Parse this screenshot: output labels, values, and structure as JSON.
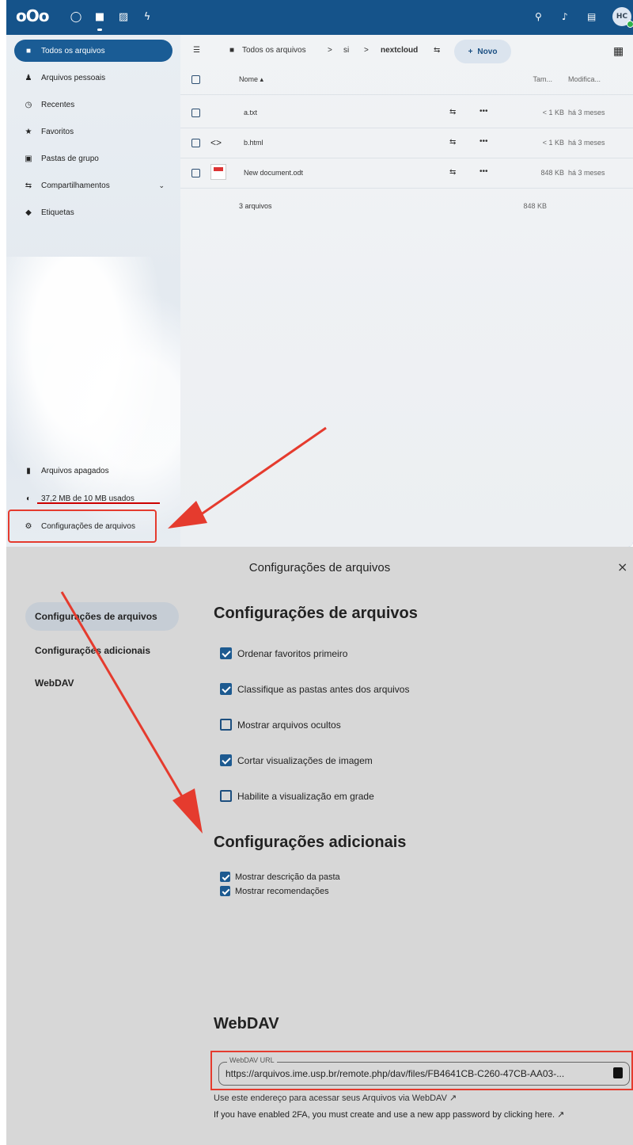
{
  "topbar": {
    "logo": "oOo",
    "apps": [
      "dashboard-icon",
      "files-icon",
      "photos-icon",
      "activity-icon"
    ],
    "avatar_initials": "HC"
  },
  "sidebar": {
    "items": [
      {
        "label": "Todos os arquivos",
        "icon": "folder-icon",
        "glyph": "■"
      },
      {
        "label": "Arquivos pessoais",
        "icon": "user-icon",
        "glyph": "♟"
      },
      {
        "label": "Recentes",
        "icon": "clock-icon",
        "glyph": "◷"
      },
      {
        "label": "Favoritos",
        "icon": "star-icon",
        "glyph": "★"
      },
      {
        "label": "Pastas de grupo",
        "icon": "group-folder-icon",
        "glyph": "▣"
      },
      {
        "label": "Compartilhamentos",
        "icon": "share-icon",
        "glyph": "⇆"
      },
      {
        "label": "Etiquetas",
        "icon": "tag-icon",
        "glyph": "◆"
      }
    ],
    "trash_label": "Arquivos apagados",
    "quota_label": "37,2 MB de 10 MB usados",
    "quota_fraction": 3.72,
    "settings_label": "Configurações de arquivos"
  },
  "files": {
    "breadcrumb": [
      "Todos os arquivos",
      "si",
      "nextcloud"
    ],
    "new_button": "Novo",
    "columns": {
      "name": "Nome",
      "size": "Tam...",
      "modified": "Modifica..."
    },
    "rows": [
      {
        "name": "a.txt",
        "size": "< 1 KB",
        "modified": "há 3 meses"
      },
      {
        "name": "b.html",
        "size": "< 1 KB",
        "modified": "há 3 meses"
      },
      {
        "name": "New document.odt",
        "size": "848 KB",
        "modified": "há 3 meses"
      }
    ],
    "summary": {
      "count": "3 arquivos",
      "size": "848 KB"
    }
  },
  "dialog": {
    "title": "Configurações de arquivos",
    "close": "×",
    "nav": [
      "Configurações de arquivos",
      "Configurações adicionais",
      "WebDAV"
    ],
    "section1": {
      "heading": "Configurações de arquivos",
      "options": [
        {
          "label": "Ordenar favoritos primeiro",
          "checked": true
        },
        {
          "label": "Classifique as pastas antes dos arquivos",
          "checked": true
        },
        {
          "label": "Mostrar arquivos ocultos",
          "checked": false
        },
        {
          "label": "Cortar visualizações de imagem",
          "checked": true
        },
        {
          "label": "Habilite a visualização em grade",
          "checked": false
        }
      ]
    },
    "section2": {
      "heading": "Configurações adicionais",
      "options": [
        {
          "label": "Mostrar descrição da pasta",
          "checked": true
        },
        {
          "label": "Mostrar recomendações",
          "checked": true
        }
      ]
    },
    "webdav": {
      "heading": "WebDAV",
      "field_label": "WebDAV URL",
      "url": "https://arquivos.ime.usp.br/remote.php/dav/files/FB4641CB-C260-47CB-AA03-...",
      "help_use": "Use este endereço para acessar seus Arquivos via WebDAV ↗",
      "help_2fa": "If you have enabled 2FA, you must create and use a new app password by clicking here. ↗"
    }
  },
  "colors": {
    "accent": "#1a5c95",
    "highlight": "#e53b2e",
    "dialog_bg": "#d7d7d7"
  }
}
